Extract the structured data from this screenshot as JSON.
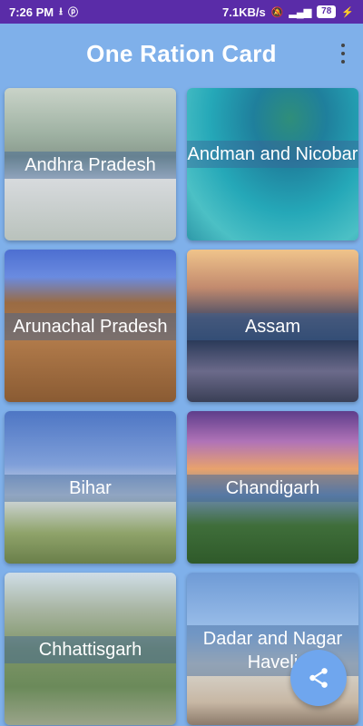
{
  "status_bar": {
    "time": "7:26 PM",
    "speed": "7.1KB/s",
    "battery": "78",
    "icons": [
      "usb-icon",
      "p-icon",
      "mute-icon",
      "volte-icon",
      "signal-icon",
      "battery-icon",
      "charging-icon"
    ]
  },
  "app_bar": {
    "title": "One Ration Card",
    "menu_icon": "more-vertical-icon"
  },
  "states": [
    {
      "label": "Andhra Pradesh"
    },
    {
      "label": "Andman and Nicobar"
    },
    {
      "label": "Arunachal Pradesh"
    },
    {
      "label": "Assam"
    },
    {
      "label": "Bihar"
    },
    {
      "label": "Chandigarh"
    },
    {
      "label": "Chhattisgarh"
    },
    {
      "label": "Dadar and Nagar Haveli"
    }
  ],
  "fab": {
    "icon": "share-icon"
  },
  "colors": {
    "status_bar": "#5a2ca8",
    "app_bar": "#7fb0ea",
    "fab": "#6fa6ee"
  }
}
